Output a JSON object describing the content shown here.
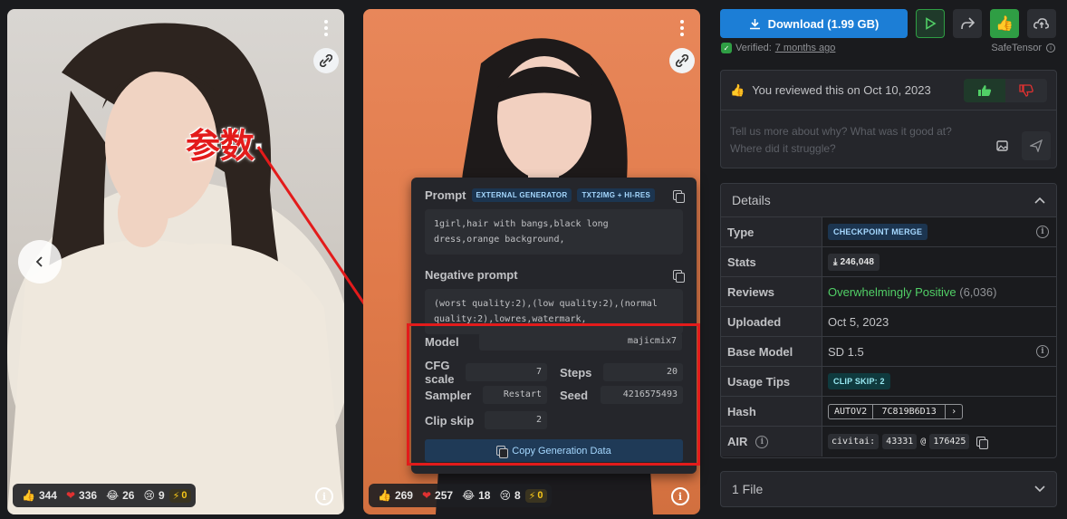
{
  "cards": [
    {
      "reactions": {
        "like": "344",
        "heart": "336",
        "laugh": "26",
        "cry": "9",
        "bolt": "0"
      }
    },
    {
      "reactions": {
        "like": "269",
        "heart": "257",
        "laugh": "18",
        "cry": "8",
        "bolt": "0"
      }
    }
  ],
  "annotation": {
    "text": "参数"
  },
  "generation": {
    "prompt_label": "Prompt",
    "tag_external": "EXTERNAL GENERATOR",
    "tag_mode": "TXT2IMG + HI-RES",
    "prompt": "1girl,hair with bangs,black long dress,orange background,",
    "negative_label": "Negative prompt",
    "negative": "(worst quality:2),(low quality:2),(normal quality:2),lowres,watermark,",
    "model_label": "Model",
    "model": "majicmix7",
    "cfg_label": "CFG scale",
    "cfg": "7",
    "steps_label": "Steps",
    "steps": "20",
    "sampler_label": "Sampler",
    "sampler": "Restart",
    "seed_label": "Seed",
    "seed": "4216575493",
    "clip_label": "Clip skip",
    "clip": "2",
    "copy_label": "Copy Generation Data"
  },
  "actions": {
    "download_label": "Download (1.99 GB)",
    "verified_label": "Verified:",
    "verified_when": "7 months ago",
    "safetensor": "SafeTensor"
  },
  "review": {
    "status": "You reviewed this on Oct 10, 2023",
    "placeholder_line1": "Tell us more about why? What was it good at?",
    "placeholder_line2": "Where did it struggle?"
  },
  "details": {
    "title": "Details",
    "rows": {
      "type": {
        "label": "Type",
        "value": "CHECKPOINT MERGE"
      },
      "stats": {
        "label": "Stats",
        "value": "246,048"
      },
      "reviews": {
        "label": "Reviews",
        "value": "Overwhelmingly Positive",
        "count": "(6,036)"
      },
      "uploaded": {
        "label": "Uploaded",
        "value": "Oct 5, 2023"
      },
      "base": {
        "label": "Base Model",
        "value": "SD 1.5"
      },
      "tips": {
        "label": "Usage Tips",
        "value": "CLIP SKIP: 2"
      },
      "hash": {
        "label": "Hash",
        "algo": "AUTOV2",
        "value": "7C819B6D13"
      },
      "air": {
        "label": "AIR",
        "prefix": "civitai:",
        "model_id": "43331",
        "at": "@",
        "version_id": "176425"
      }
    }
  },
  "files": {
    "label": "1 File"
  },
  "colors": {
    "accent": "#1c7ed6",
    "positive": "#51cf66",
    "annotation": "#e31b1b"
  }
}
